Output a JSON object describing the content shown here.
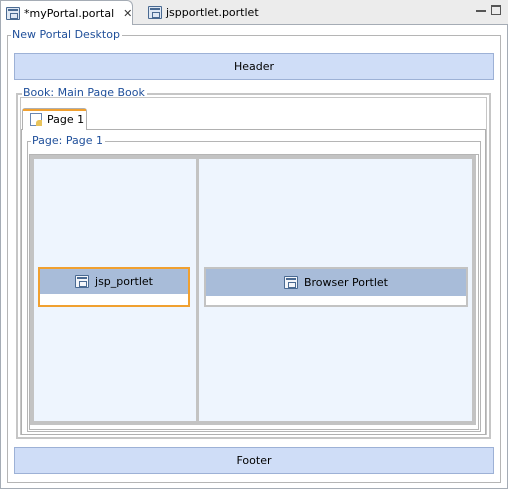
{
  "tabs": [
    {
      "label": "*myPortal.portal",
      "active": true,
      "icon": "portal-file-icon"
    },
    {
      "label": "jspportlet.portlet",
      "active": false,
      "icon": "portlet-file-icon"
    }
  ],
  "close_glyph": "✕",
  "desktop": {
    "legend": "New Portal Desktop"
  },
  "header": {
    "label": "Header"
  },
  "footer": {
    "label": "Footer"
  },
  "book": {
    "legend": "Book: Main Page Book"
  },
  "page_tab": {
    "label": "Page 1"
  },
  "page": {
    "legend": "Page: Page 1"
  },
  "portlets": [
    {
      "title": "jsp_portlet",
      "selected": true
    },
    {
      "title": "Browser Portlet",
      "selected": false
    }
  ],
  "colors": {
    "legend_text": "#1f4f9a",
    "bar_fill": "#cfddf7",
    "portlet_title": "#a8bcd9",
    "selection": "#f0a030",
    "column_fill": "#eef5fe"
  }
}
